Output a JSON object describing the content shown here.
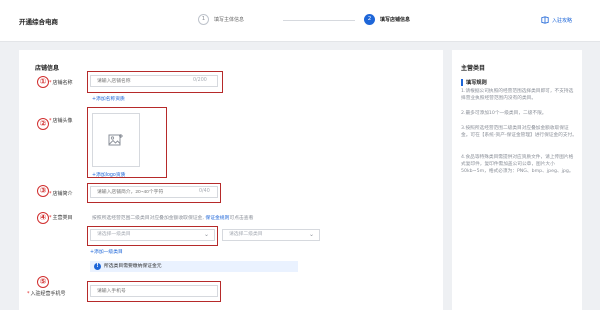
{
  "header": {
    "app_title": "开通综合电商",
    "steps": [
      {
        "num": "1",
        "label": "填写主体信息"
      },
      {
        "num": "2",
        "label": "填写店铺信息"
      }
    ],
    "entry_guide": "入驻攻略"
  },
  "form": {
    "section_title": "店铺信息",
    "store_name": {
      "marker": "①",
      "label": "店铺名称",
      "placeholder": "请输入店铺名称",
      "counter": "0/200",
      "add_link": "+添加名称资质"
    },
    "store_avatar": {
      "marker": "②",
      "label": "店铺头像",
      "add_link": "+添加logo资质"
    },
    "store_intro": {
      "marker": "③",
      "label": "店铺简介",
      "placeholder": "请输入店铺简介，20~40个字符",
      "counter": "0/40"
    },
    "main_category": {
      "marker": "④",
      "label": "主营类目",
      "hint_prefix": "按照所选经营范围二级类目对应叠加金额收取保证金,",
      "hint_link": "保证金规则",
      "hint_suffix": "可点击查看",
      "select_primary": "请选择一级类目",
      "select_secondary": "请选择二级类目",
      "add_link": "+添加一级类目",
      "notice": "所选类目需要缴纳保证金元"
    },
    "admin_phone": {
      "marker": "⑤",
      "label": "入驻经营手机号",
      "placeholder": "请输入手机号"
    }
  },
  "sidebar": {
    "title": "主营类目",
    "subtitle": "填写规则",
    "rules": [
      "1.请根据公司执照的经营范围选择类目即可，不支持选择营业执照经营范围内没有的类目。",
      "2.最多可添加10个一级类目，二级不限。",
      "3.按照所选经营范围二级类目对应叠加金额收取保证金。可在【系统-资产-保证金管理】进行保证金的支付。",
      "4.食品等特殊类目需提供对应资质文件，请上传图片格式复印件，复印件需加盖公司公章，图片大小50kb~5m，格式必须为：PNG、bmp、jpeg、jpg。"
    ]
  },
  "colors": {
    "accent": "#1e66d8",
    "highlight_border": "#b62a2a",
    "required": "#e02424"
  }
}
